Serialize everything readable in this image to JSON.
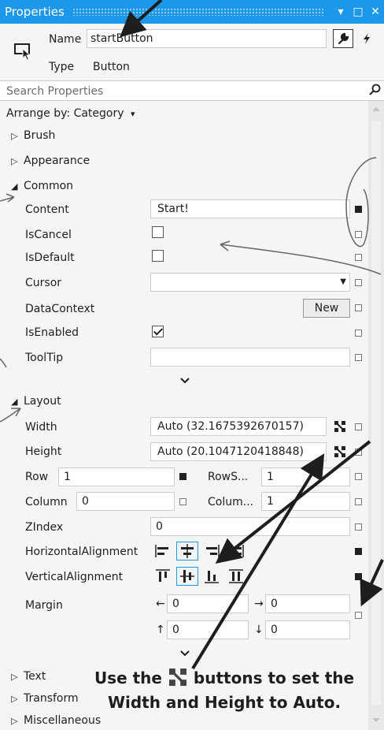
{
  "window": {
    "title": "Properties",
    "controls": [
      "▾",
      "□",
      "✕"
    ]
  },
  "header": {
    "name_label": "Name",
    "name_value": "startButton",
    "type_label": "Type",
    "type_value": "Button",
    "icons": [
      "button-control-icon",
      "wrench-icon",
      "bolt-icon"
    ]
  },
  "search": {
    "placeholder": "Search Properties",
    "icon": "search-icon"
  },
  "arrange": {
    "label": "Arrange by: Category",
    "arrow": "▾"
  },
  "categories": {
    "brush": "Brush",
    "appearance": "Appearance",
    "common": "Common",
    "layout": "Layout",
    "text": "Text",
    "transform": "Transform",
    "misc": "Miscellaneous"
  },
  "common": {
    "content": {
      "label": "Content",
      "value": "Start!"
    },
    "iscancel": {
      "label": "IsCancel",
      "checked": false
    },
    "isdefault": {
      "label": "IsDefault",
      "checked": false
    },
    "cursor": {
      "label": "Cursor",
      "value": ""
    },
    "datacontext": {
      "label": "DataContext",
      "button": "New"
    },
    "isenabled": {
      "label": "IsEnabled",
      "checked": true
    },
    "tooltip": {
      "label": "ToolTip",
      "value": ""
    }
  },
  "layout": {
    "width": {
      "label": "Width",
      "value": "Auto (32.1675392670157)"
    },
    "height": {
      "label": "Height",
      "value": "Auto (20.1047120418848)"
    },
    "row": {
      "label": "Row",
      "value": "1"
    },
    "rowspan": {
      "label": "RowS...",
      "value": "1"
    },
    "column": {
      "label": "Column",
      "value": "0"
    },
    "columnspan": {
      "label": "Colum...",
      "value": "1"
    },
    "zindex": {
      "label": "ZIndex",
      "value": "0"
    },
    "halign": {
      "label": "HorizontalAlignment",
      "selected": "center"
    },
    "valign": {
      "label": "VerticalAlignment",
      "selected": "center"
    },
    "margin": {
      "label": "Margin",
      "left": "0",
      "right": "0",
      "top": "0",
      "bottom": "0",
      "arrows": [
        "←",
        "→",
        "↑",
        "↓"
      ]
    }
  },
  "callout": {
    "line1_a": "Use the",
    "line1_b": "buttons to set the",
    "line2": "Width and Height to Auto."
  },
  "colors": {
    "accent": "#1c97ea",
    "panel": "#f5f5f5",
    "category_band": "#e8e8e8"
  }
}
